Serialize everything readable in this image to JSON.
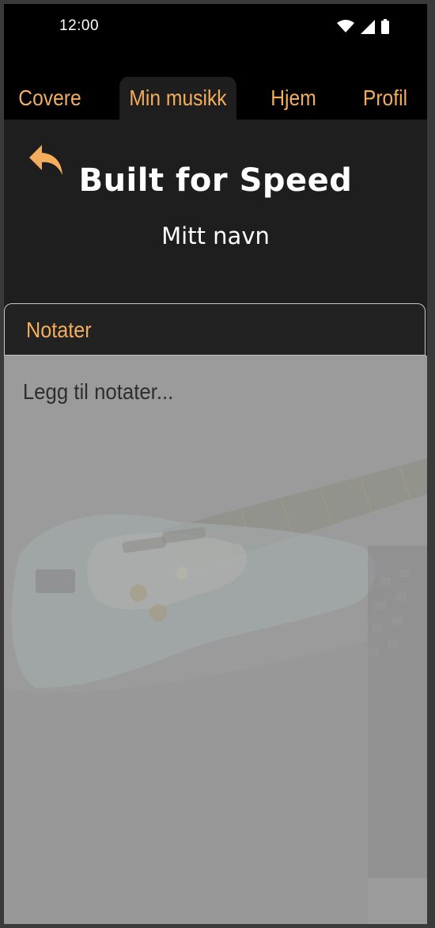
{
  "status_bar": {
    "time": "12:00",
    "icons": [
      "wifi-icon",
      "cellular-signal-icon",
      "battery-icon"
    ]
  },
  "tabs": [
    {
      "label": "Covere",
      "active": false
    },
    {
      "label": "Min musikk",
      "active": true
    },
    {
      "label": "Hjem",
      "active": false
    },
    {
      "label": "Profil",
      "active": false
    }
  ],
  "song": {
    "title": "Built for Speed",
    "artist": "Mitt navn"
  },
  "back_button": {
    "icon": "reply-arrow-icon"
  },
  "notes": {
    "header": "Notater",
    "placeholder": "Legg til notater...",
    "value": ""
  },
  "colors": {
    "accent": "#f3ad5c",
    "background": "#1e1e1e",
    "top_bar": "#000000",
    "notes_body": "#9b9b9b"
  }
}
